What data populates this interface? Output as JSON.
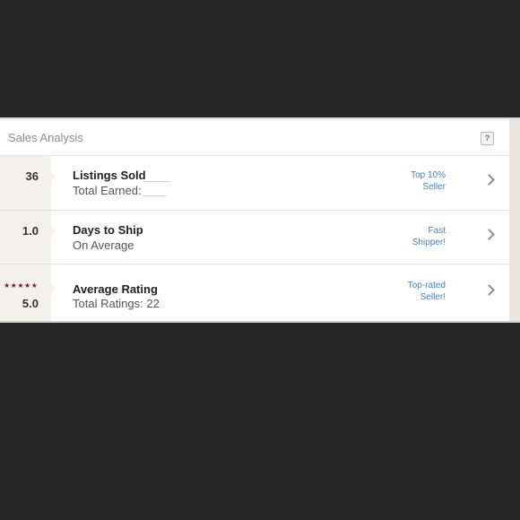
{
  "header": {
    "title": "Sales Analysis",
    "help_icon": "question-icon"
  },
  "rows": [
    {
      "value": "36",
      "title": "Listings Sold",
      "subtitle": "Total Earned:",
      "badge_line1": "Top 10%",
      "badge_line2": "Seller"
    },
    {
      "value": "1.0",
      "title": "Days to Ship",
      "subtitle": "On Average",
      "badge_line1": "Fast",
      "badge_line2": "Shipper!"
    },
    {
      "value": "5.0",
      "stars": "★★★★★",
      "title": "Average Rating",
      "subtitle": "Total Ratings: 22",
      "badge_line1": "Top-rated",
      "badge_line2": "Seller!"
    }
  ],
  "colors": {
    "accent_link": "#4a82b8",
    "star": "#7a1f2b",
    "left_column_bg": "#f4f0eb"
  }
}
